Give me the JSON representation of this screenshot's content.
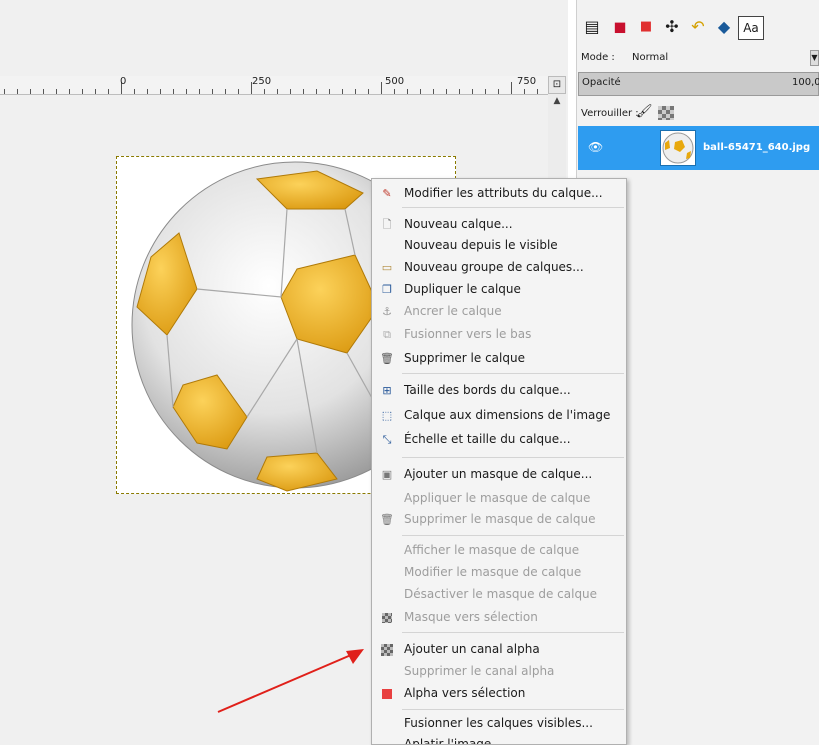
{
  "canvas": {
    "ruler_labels": [
      "0",
      "250",
      "500",
      "750"
    ]
  },
  "dock": {
    "mode_label": "Mode :",
    "mode_value": "Normal",
    "opacity_label": "Opacité",
    "opacity_value": "100,0",
    "lock_label": "Verrouiller :",
    "text_tool_tab": "Aa",
    "layer": {
      "name": "ball-65471_640.jpg",
      "selected": true,
      "visible": true
    }
  },
  "context_menu": {
    "items": [
      {
        "label": "Modifier les attributs du calque...",
        "icon": "edit-icon",
        "enabled": true
      },
      {
        "label": "Nouveau calque...",
        "icon": "new-page-icon",
        "enabled": true
      },
      {
        "label": "Nouveau depuis le visible",
        "icon": "",
        "enabled": true
      },
      {
        "label": "Nouveau groupe de calques...",
        "icon": "folder-icon",
        "enabled": true
      },
      {
        "label": "Dupliquer le calque",
        "icon": "duplicate-icon",
        "enabled": true
      },
      {
        "label": "Ancrer le calque",
        "icon": "anchor-icon",
        "enabled": false
      },
      {
        "label": "Fusionner vers le bas",
        "icon": "merge-down-icon",
        "enabled": false
      },
      {
        "label": "Supprimer le calque",
        "icon": "trash-icon",
        "enabled": true
      },
      {
        "label": "Taille des bords du calque...",
        "icon": "boundary-size-icon",
        "enabled": true
      },
      {
        "label": "Calque aux dimensions de l'image",
        "icon": "fit-image-icon",
        "enabled": true
      },
      {
        "label": "Échelle et taille du calque...",
        "icon": "scale-icon",
        "enabled": true
      },
      {
        "label": "Ajouter un masque de calque...",
        "icon": "add-mask-icon",
        "enabled": true
      },
      {
        "label": "Appliquer le masque de calque",
        "icon": "",
        "enabled": false
      },
      {
        "label": "Supprimer le masque de calque",
        "icon": "trash-icon",
        "enabled": false
      },
      {
        "label": "Afficher le masque de calque",
        "icon": "",
        "enabled": false
      },
      {
        "label": "Modifier le masque de calque",
        "icon": "",
        "enabled": false
      },
      {
        "label": "Désactiver le masque de calque",
        "icon": "",
        "enabled": false
      },
      {
        "label": "Masque vers sélection",
        "icon": "mask-selection-icon",
        "enabled": false
      },
      {
        "label": "Ajouter un canal alpha",
        "icon": "alpha-channel-icon",
        "enabled": true
      },
      {
        "label": "Supprimer le canal alpha",
        "icon": "",
        "enabled": false
      },
      {
        "label": "Alpha vers sélection",
        "icon": "alpha-selection-icon",
        "enabled": true
      },
      {
        "label": "Fusionner les calques visibles...",
        "icon": "",
        "enabled": true
      },
      {
        "label": "Aplatir l'image",
        "icon": "",
        "enabled": true
      }
    ]
  },
  "colors": {
    "selected_layer": "#2e9cf0",
    "ball_yellow": "#e8a80c",
    "annotation_arrow": "#e0201a"
  }
}
